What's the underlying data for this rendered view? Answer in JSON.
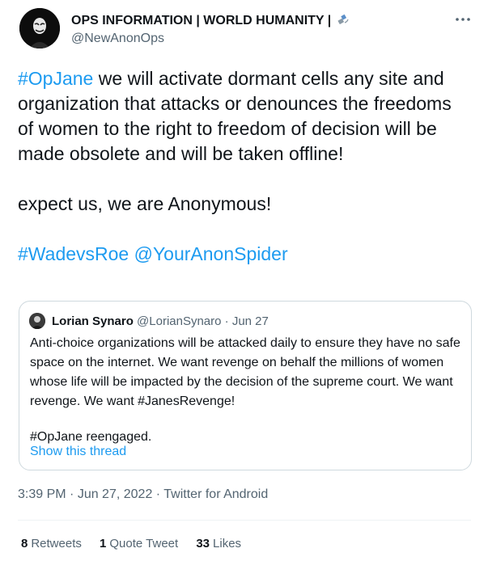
{
  "author": {
    "name": "OPS INFORMATION | WORLD HUMANITY |",
    "handle": "@NewAnonOps"
  },
  "tweet": {
    "hashtag": "#OpJane",
    "line1_rest": " we will activate dormant cells any site and organization that attacks or denounces the freedoms of women to the right to freedom of decision will be made obsolete and will be taken offline!",
    "line2": "expect us, we are Anonymous!",
    "tag1": "#WadevsRoe",
    "tag2": "@YourAnonSpider"
  },
  "quote": {
    "name": "Lorian Synaro",
    "handle": "@LorianSynaro",
    "sep": " · ",
    "date": "Jun 27",
    "para1": "Anti-choice organizations will be attacked daily to ensure they have no safe space on the internet. We want revenge on behalf the millions of women whose life will be impacted by the decision of the supreme court. We want revenge. We want #JanesRevenge!",
    "para2": "#OpJane reengaged.",
    "show_thread": "Show this thread"
  },
  "meta": {
    "time": "3:39 PM",
    "date": "Jun 27, 2022",
    "source": "Twitter for Android",
    "dot": " · "
  },
  "stats": {
    "retweets_count": "8",
    "retweets_label": "Retweets",
    "quotes_count": "1",
    "quotes_label": "Quote Tweet",
    "likes_count": "33",
    "likes_label": "Likes"
  },
  "colors": {
    "link": "#1d9bf0",
    "secondary": "#536471",
    "text": "#0f1419",
    "border": "#cfd9de"
  },
  "icons": [
    "satellite-icon",
    "more-icon"
  ]
}
